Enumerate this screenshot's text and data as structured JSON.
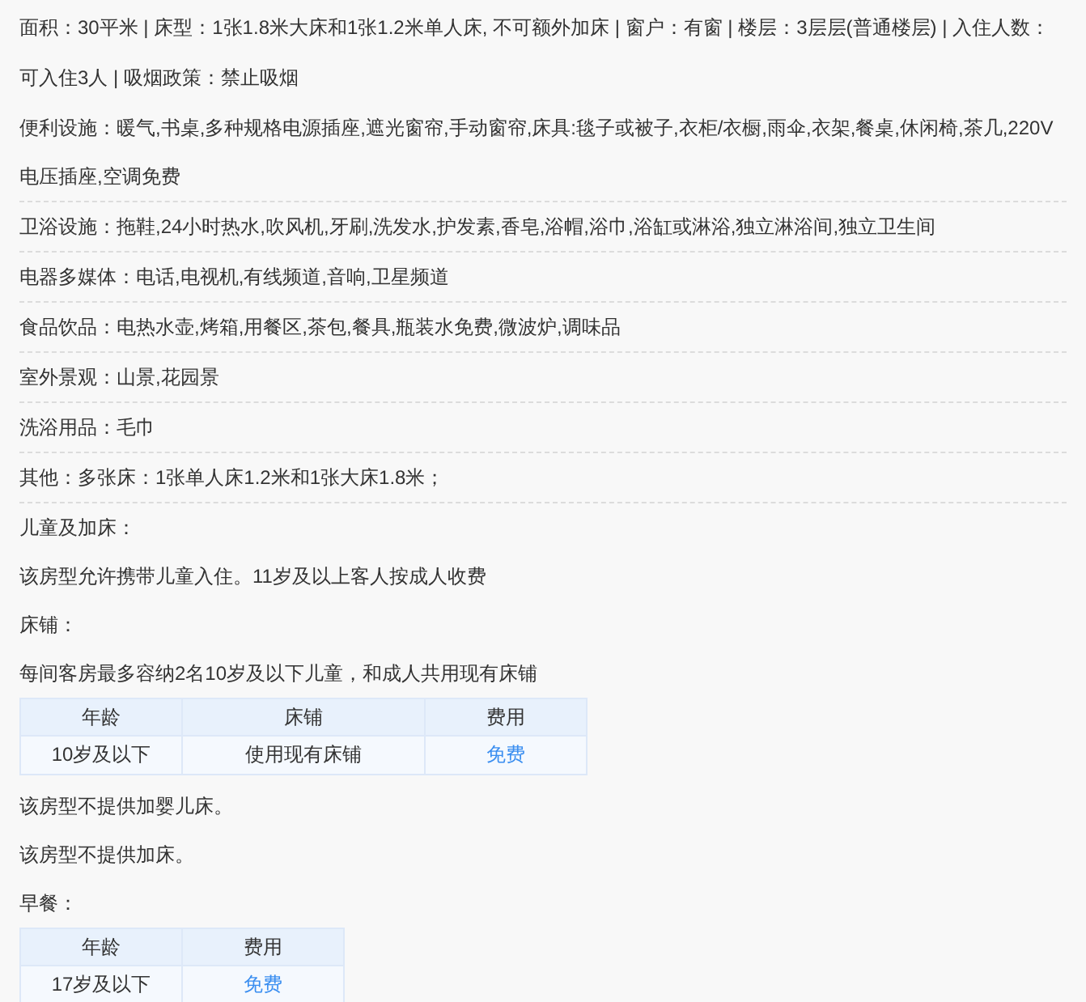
{
  "summary": "面积：30平米 | 床型：1张1.8米大床和1张1.2米单人床, 不可额外加床 | 窗户：有窗 | 楼层：3层层(普通楼层) | 入住人数：可入住3人 | 吸烟政策：禁止吸烟",
  "facilities": [
    "便利设施：暖气,书桌,多种规格电源插座,遮光窗帘,手动窗帘,床具:毯子或被子,衣柜/衣橱,雨伞,衣架,餐桌,休闲椅,茶几,220V电压插座,空调免费",
    "卫浴设施：拖鞋,24小时热水,吹风机,牙刷,洗发水,护发素,香皂,浴帽,浴巾,浴缸或淋浴,独立淋浴间,独立卫生间",
    "电器多媒体：电话,电视机,有线频道,音响,卫星频道",
    "食品饮品：电热水壶,烤箱,用餐区,茶包,餐具,瓶装水免费,微波炉,调味品",
    "室外景观：山景,花园景",
    "洗浴用品：毛巾",
    "其他：多张床：1张单人床1.2米和1张大床1.8米；"
  ],
  "policy": [
    {
      "kind": "text",
      "text": "儿童及加床："
    },
    {
      "kind": "text",
      "text": "该房型允许携带儿童入住。11岁及以上客人按成人收费"
    },
    {
      "kind": "text",
      "text": "床铺："
    },
    {
      "kind": "text",
      "text": "每间客房最多容纳2名10岁及以下儿童，和成人共用现有床铺"
    },
    {
      "kind": "table",
      "columns": [
        "年龄",
        "床铺",
        "费用"
      ],
      "rows": [
        [
          {
            "kind": "plain",
            "text": "10岁及以下"
          },
          {
            "kind": "plain",
            "text": "使用现有床铺"
          },
          {
            "kind": "price",
            "text": "免费"
          }
        ]
      ]
    },
    {
      "kind": "text",
      "text": "该房型不提供加婴儿床。"
    },
    {
      "kind": "text",
      "text": "该房型不提供加床。"
    },
    {
      "kind": "text",
      "text": "早餐："
    },
    {
      "kind": "table",
      "columns": [
        "年龄",
        "费用"
      ],
      "rows": [
        [
          {
            "kind": "plain",
            "text": "17岁及以下"
          },
          {
            "kind": "price",
            "text": "免费"
          }
        ]
      ]
    }
  ]
}
